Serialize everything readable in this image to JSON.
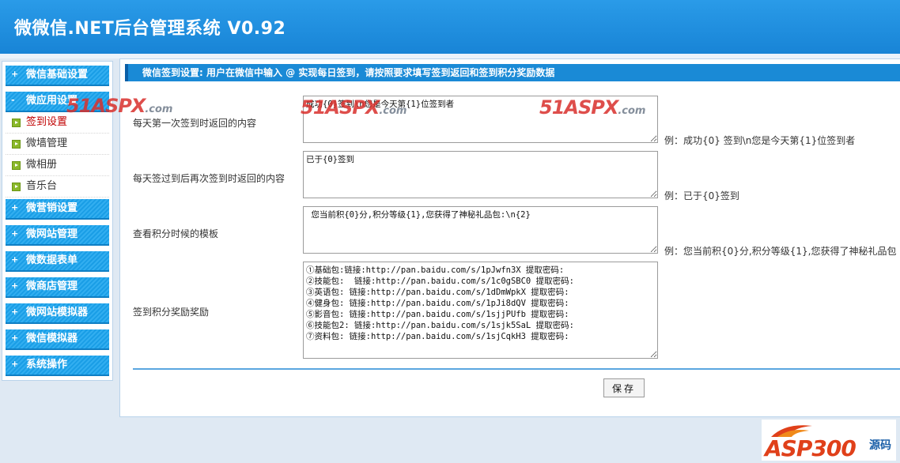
{
  "header": {
    "title": "微微信.NET后台管理系统 V0.92"
  },
  "sidebar": {
    "groups": [
      {
        "label": "微信基础设置",
        "expanded": false
      },
      {
        "label": "微应用设置",
        "expanded": true,
        "items": [
          {
            "label": "签到设置",
            "active": true
          },
          {
            "label": "微墙管理",
            "active": false
          },
          {
            "label": "微相册",
            "active": false
          },
          {
            "label": "音乐台",
            "active": false
          }
        ]
      },
      {
        "label": "微营销设置",
        "expanded": false
      },
      {
        "label": "微网站管理",
        "expanded": false
      },
      {
        "label": "微数据表单",
        "expanded": false
      },
      {
        "label": "微商店管理",
        "expanded": false
      },
      {
        "label": "微网站模拟器",
        "expanded": false
      },
      {
        "label": "微信模拟器",
        "expanded": false
      },
      {
        "label": "系统操作",
        "expanded": false
      }
    ],
    "expand_icon": "+",
    "collapse_icon": "-"
  },
  "main": {
    "breadcrumb": "微信签到设置: 用户在微信中输入 @ 实现每日签到，请按照要求填写签到返回和签到积分奖励数据",
    "fields": [
      {
        "label": "每天第一次签到时返回的内容",
        "value": "成功{0}签到\\n您是今天第{1}位签到者",
        "example": "例：成功{0} 签到\\n您是今天第{1}位签到者"
      },
      {
        "label": "每天签过到后再次签到时返回的内容",
        "value": "已于{0}签到",
        "example": "例：已于{0}签到"
      },
      {
        "label": "查看积分时候的模板",
        "value": " 您当前积{0}分,积分等级{1},您获得了神秘礼品包:\\n{2}",
        "example": "例：您当前积{0}分,积分等级{1},您获得了神秘礼品包"
      },
      {
        "label": "签到积分奖励奖励",
        "value": "①基础包:链接:http://pan.baidu.com/s/1pJwfn3X 提取密码:\n②技能包:  链接:http://pan.baidu.com/s/1c0gSBC0 提取密码:\n③英语包: 链接:http://pan.baidu.com/s/1dDmWpkX 提取密码:\n④健身包: 链接:http://pan.baidu.com/s/1pJi8dQV 提取密码:\n⑤影音包: 链接:http://pan.baidu.com/s/1sjjPUfb 提取密码:\n⑥技能包2: 链接:http://pan.baidu.com/s/1sjk5SaL 提取密码:\n⑦资料包: 链接:http://pan.baidu.com/s/1sjCqkH3 提取密码:",
        "example": ""
      }
    ],
    "save_label": "保存"
  },
  "watermarks": {
    "brand": "51ASPX",
    "domain": ".com",
    "logo_text": "ASP300",
    "logo_suffix": "源码"
  },
  "colors": {
    "header_blue": "#1b8fe0",
    "menu_blue": "#1aa0e8",
    "active_red": "#c00000",
    "watermark_red": "#d9302c"
  }
}
